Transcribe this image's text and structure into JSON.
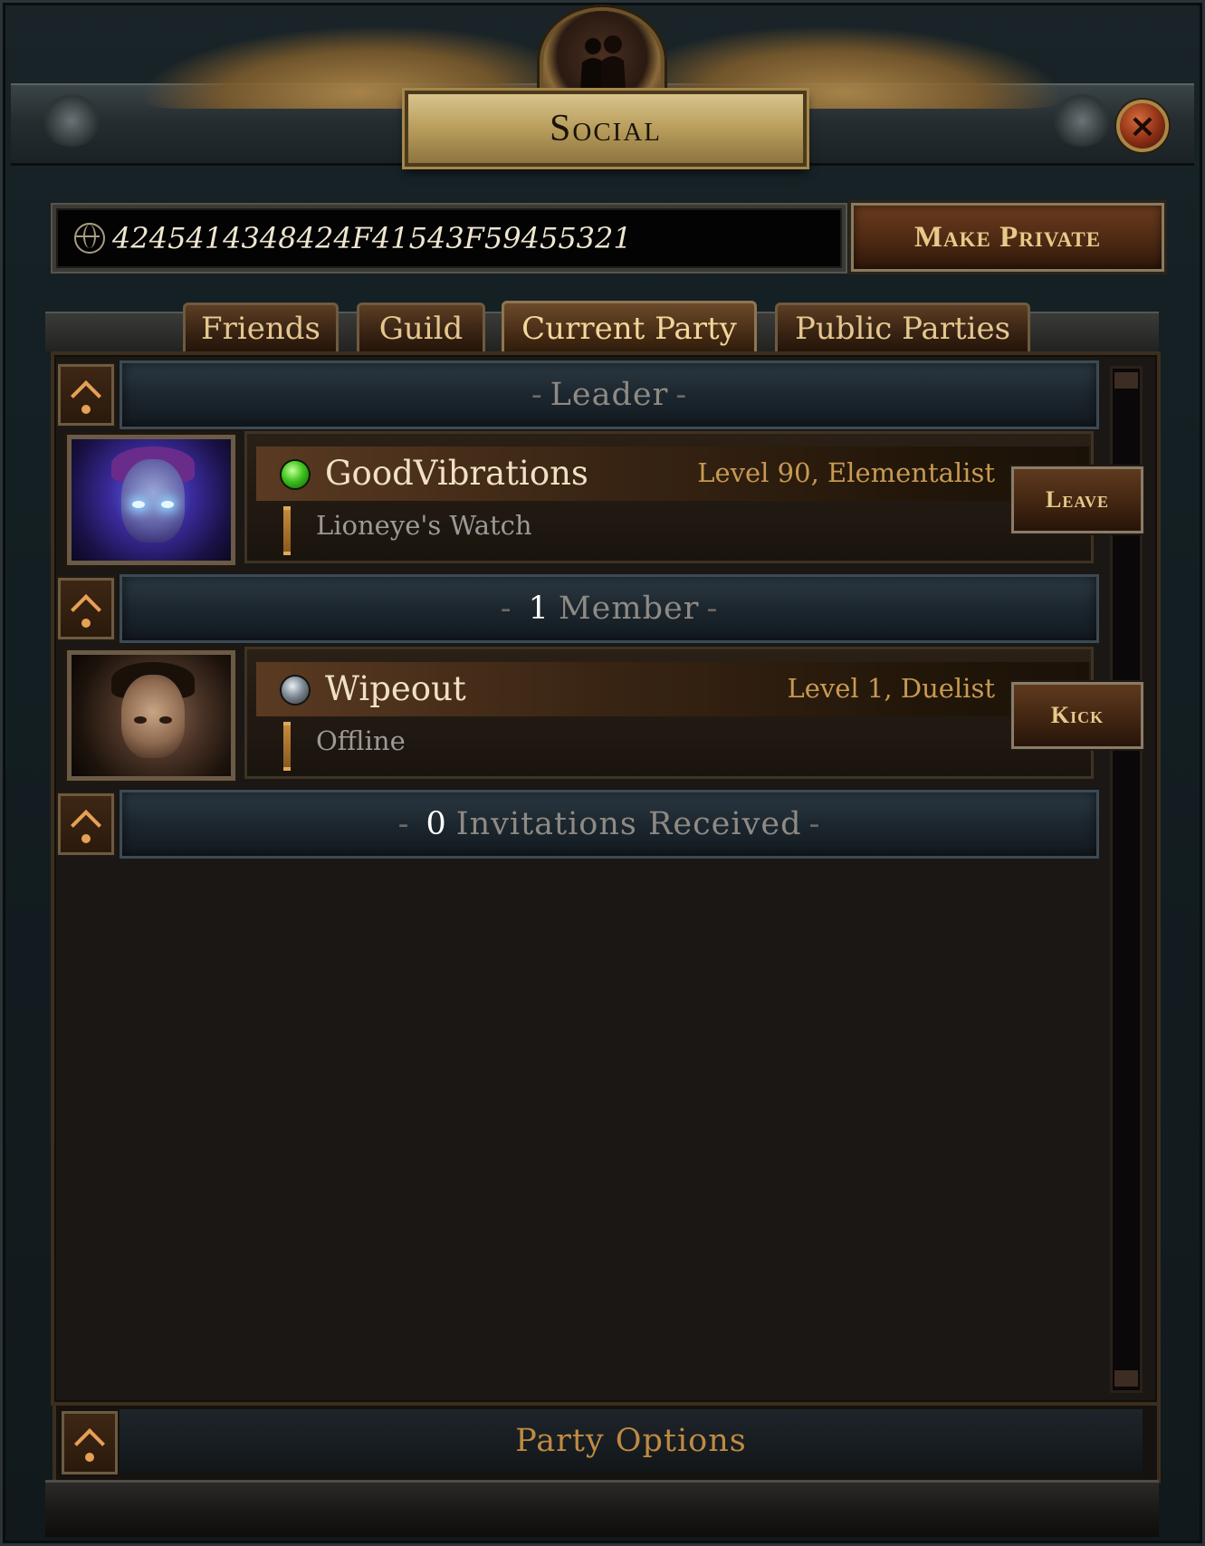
{
  "window": {
    "title": "Social",
    "close_icon": "close-icon"
  },
  "party_id": {
    "value": "4245414348424F41543F59455321",
    "icon": "globe-icon"
  },
  "make_private_label": "Make Private",
  "tabs": [
    {
      "label": "Friends",
      "active": false
    },
    {
      "label": "Guild",
      "active": false
    },
    {
      "label": "Current Party",
      "active": true
    },
    {
      "label": "Public Parties",
      "active": false
    }
  ],
  "sections": {
    "leader": {
      "dash_left": "-",
      "label": "Leader",
      "dash_right": "-"
    },
    "members": {
      "dash_left": "-",
      "count": "1",
      "label": "Member",
      "dash_right": "-"
    },
    "invitations": {
      "dash_left": "-",
      "count": "0",
      "label": "Invitations Received",
      "dash_right": "-"
    }
  },
  "leader": {
    "name": "GoodVibrations",
    "level_class": "Level 90, Elementalist",
    "zone": "Lioneye's Watch",
    "status": "online",
    "action_label": "Leave"
  },
  "member": {
    "name": "Wipeout",
    "level_class": "Level 1, Duelist",
    "zone": "Offline",
    "status": "offline",
    "action_label": "Kick"
  },
  "party_options_label": "Party Options",
  "colors": {
    "accent_gold": "#e9c98a",
    "online_green": "#3fc41e",
    "offline_grey": "#7f8a94",
    "level_text": "#c79a52"
  }
}
